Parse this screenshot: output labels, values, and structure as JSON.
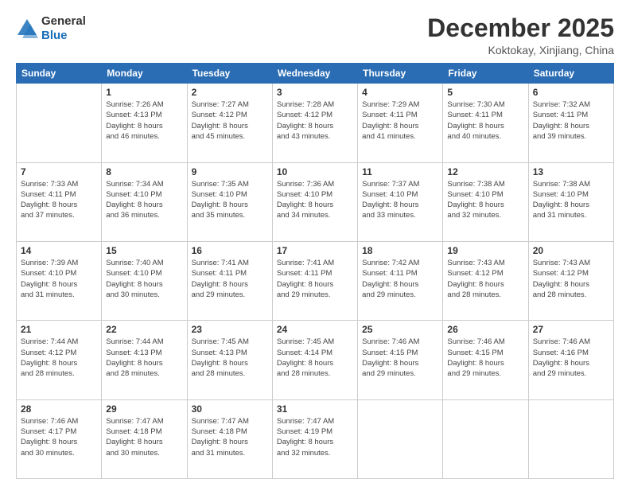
{
  "logo": {
    "general": "General",
    "blue": "Blue"
  },
  "header": {
    "month": "December 2025",
    "location": "Koktokay, Xinjiang, China"
  },
  "days_of_week": [
    "Sunday",
    "Monday",
    "Tuesday",
    "Wednesday",
    "Thursday",
    "Friday",
    "Saturday"
  ],
  "weeks": [
    [
      {
        "day": "",
        "info": ""
      },
      {
        "day": "1",
        "info": "Sunrise: 7:26 AM\nSunset: 4:13 PM\nDaylight: 8 hours\nand 46 minutes."
      },
      {
        "day": "2",
        "info": "Sunrise: 7:27 AM\nSunset: 4:12 PM\nDaylight: 8 hours\nand 45 minutes."
      },
      {
        "day": "3",
        "info": "Sunrise: 7:28 AM\nSunset: 4:12 PM\nDaylight: 8 hours\nand 43 minutes."
      },
      {
        "day": "4",
        "info": "Sunrise: 7:29 AM\nSunset: 4:11 PM\nDaylight: 8 hours\nand 41 minutes."
      },
      {
        "day": "5",
        "info": "Sunrise: 7:30 AM\nSunset: 4:11 PM\nDaylight: 8 hours\nand 40 minutes."
      },
      {
        "day": "6",
        "info": "Sunrise: 7:32 AM\nSunset: 4:11 PM\nDaylight: 8 hours\nand 39 minutes."
      }
    ],
    [
      {
        "day": "7",
        "info": "Sunrise: 7:33 AM\nSunset: 4:11 PM\nDaylight: 8 hours\nand 37 minutes."
      },
      {
        "day": "8",
        "info": "Sunrise: 7:34 AM\nSunset: 4:10 PM\nDaylight: 8 hours\nand 36 minutes."
      },
      {
        "day": "9",
        "info": "Sunrise: 7:35 AM\nSunset: 4:10 PM\nDaylight: 8 hours\nand 35 minutes."
      },
      {
        "day": "10",
        "info": "Sunrise: 7:36 AM\nSunset: 4:10 PM\nDaylight: 8 hours\nand 34 minutes."
      },
      {
        "day": "11",
        "info": "Sunrise: 7:37 AM\nSunset: 4:10 PM\nDaylight: 8 hours\nand 33 minutes."
      },
      {
        "day": "12",
        "info": "Sunrise: 7:38 AM\nSunset: 4:10 PM\nDaylight: 8 hours\nand 32 minutes."
      },
      {
        "day": "13",
        "info": "Sunrise: 7:38 AM\nSunset: 4:10 PM\nDaylight: 8 hours\nand 31 minutes."
      }
    ],
    [
      {
        "day": "14",
        "info": "Sunrise: 7:39 AM\nSunset: 4:10 PM\nDaylight: 8 hours\nand 31 minutes."
      },
      {
        "day": "15",
        "info": "Sunrise: 7:40 AM\nSunset: 4:10 PM\nDaylight: 8 hours\nand 30 minutes."
      },
      {
        "day": "16",
        "info": "Sunrise: 7:41 AM\nSunset: 4:11 PM\nDaylight: 8 hours\nand 29 minutes."
      },
      {
        "day": "17",
        "info": "Sunrise: 7:41 AM\nSunset: 4:11 PM\nDaylight: 8 hours\nand 29 minutes."
      },
      {
        "day": "18",
        "info": "Sunrise: 7:42 AM\nSunset: 4:11 PM\nDaylight: 8 hours\nand 29 minutes."
      },
      {
        "day": "19",
        "info": "Sunrise: 7:43 AM\nSunset: 4:12 PM\nDaylight: 8 hours\nand 28 minutes."
      },
      {
        "day": "20",
        "info": "Sunrise: 7:43 AM\nSunset: 4:12 PM\nDaylight: 8 hours\nand 28 minutes."
      }
    ],
    [
      {
        "day": "21",
        "info": "Sunrise: 7:44 AM\nSunset: 4:12 PM\nDaylight: 8 hours\nand 28 minutes."
      },
      {
        "day": "22",
        "info": "Sunrise: 7:44 AM\nSunset: 4:13 PM\nDaylight: 8 hours\nand 28 minutes."
      },
      {
        "day": "23",
        "info": "Sunrise: 7:45 AM\nSunset: 4:13 PM\nDaylight: 8 hours\nand 28 minutes."
      },
      {
        "day": "24",
        "info": "Sunrise: 7:45 AM\nSunset: 4:14 PM\nDaylight: 8 hours\nand 28 minutes."
      },
      {
        "day": "25",
        "info": "Sunrise: 7:46 AM\nSunset: 4:15 PM\nDaylight: 8 hours\nand 29 minutes."
      },
      {
        "day": "26",
        "info": "Sunrise: 7:46 AM\nSunset: 4:15 PM\nDaylight: 8 hours\nand 29 minutes."
      },
      {
        "day": "27",
        "info": "Sunrise: 7:46 AM\nSunset: 4:16 PM\nDaylight: 8 hours\nand 29 minutes."
      }
    ],
    [
      {
        "day": "28",
        "info": "Sunrise: 7:46 AM\nSunset: 4:17 PM\nDaylight: 8 hours\nand 30 minutes."
      },
      {
        "day": "29",
        "info": "Sunrise: 7:47 AM\nSunset: 4:18 PM\nDaylight: 8 hours\nand 30 minutes."
      },
      {
        "day": "30",
        "info": "Sunrise: 7:47 AM\nSunset: 4:18 PM\nDaylight: 8 hours\nand 31 minutes."
      },
      {
        "day": "31",
        "info": "Sunrise: 7:47 AM\nSunset: 4:19 PM\nDaylight: 8 hours\nand 32 minutes."
      },
      {
        "day": "",
        "info": ""
      },
      {
        "day": "",
        "info": ""
      },
      {
        "day": "",
        "info": ""
      }
    ]
  ]
}
